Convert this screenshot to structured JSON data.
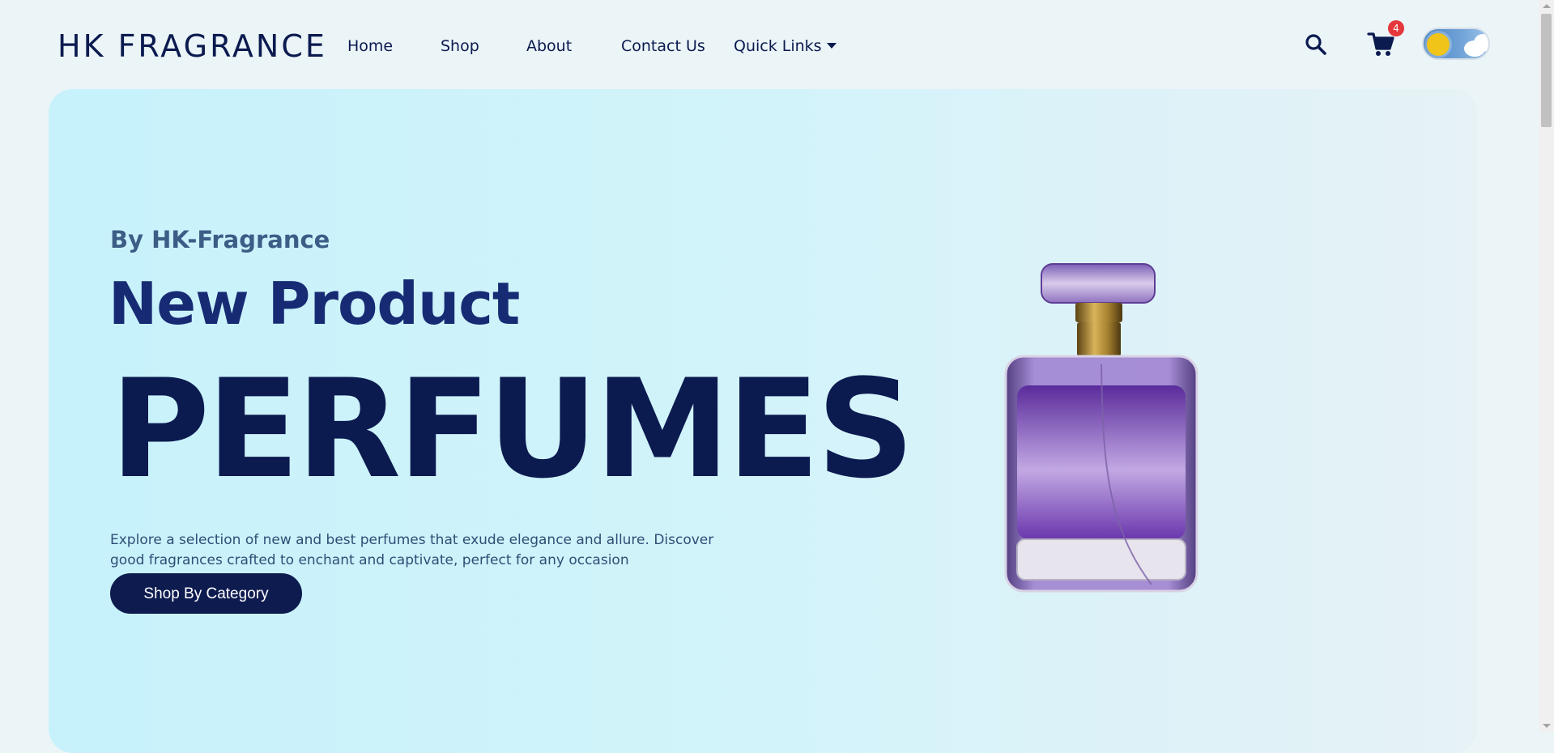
{
  "header": {
    "logo": "HK FRAGRANCE",
    "nav": {
      "home": "Home",
      "shop": "Shop",
      "about": "About",
      "contact": "Contact Us",
      "quick_links": "Quick Links"
    },
    "cart_count": "4",
    "theme": "light"
  },
  "hero": {
    "subtitle": "By HK-Fragrance",
    "headline": "New Product",
    "big_word": "PERFUMES",
    "description": "Explore a selection of new and best perfumes that exude elegance and allure. Discover good fragrances crafted to enchant and captivate, perfect for any occasion",
    "cta_label": "Shop By Category",
    "product_image": "purple-perfume-bottle"
  },
  "colors": {
    "brand_navy": "#0b1a4f",
    "headline_blue": "#172b74",
    "subtitle_blue": "#3c5d86",
    "badge_red": "#e5383b",
    "hero_bg": "#c7f2fb"
  },
  "icons": [
    "search-icon",
    "cart-icon",
    "theme-toggle-sun-icon",
    "chevron-down-icon"
  ]
}
